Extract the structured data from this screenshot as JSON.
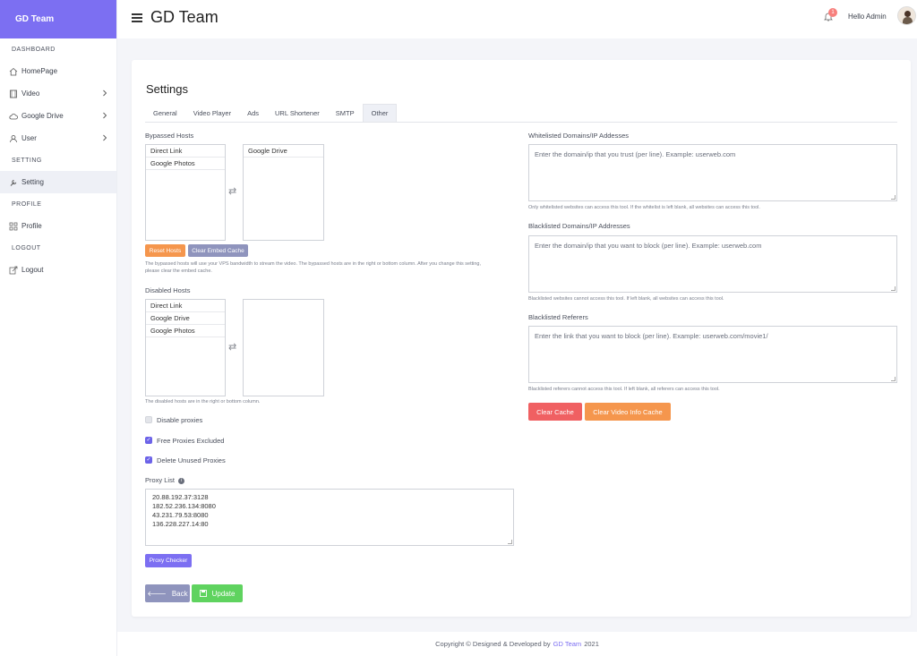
{
  "brand": "GD Team",
  "sidebar": {
    "sections": [
      {
        "title": "DASHBOARD",
        "items": [
          {
            "label": "HomePage",
            "icon": "home-icon",
            "chevron": false
          },
          {
            "label": "Video",
            "icon": "film-icon",
            "chevron": true
          },
          {
            "label": "Google Drive",
            "icon": "cloud-icon",
            "chevron": true
          },
          {
            "label": "User",
            "icon": "user-icon",
            "chevron": true
          }
        ]
      },
      {
        "title": "SETTING",
        "items": [
          {
            "label": "Setting",
            "icon": "wrench-icon",
            "active": true
          }
        ]
      },
      {
        "title": "PROFILE",
        "items": [
          {
            "label": "Profile",
            "icon": "grid-icon"
          }
        ]
      },
      {
        "title": "LOGOUT",
        "items": [
          {
            "label": "Logout",
            "icon": "logout-icon"
          }
        ]
      }
    ]
  },
  "topbar": {
    "title": "GD Team",
    "notification_count": "1",
    "greeting": "Hello Admin"
  },
  "page": {
    "title": "Settings",
    "tabs": [
      "General",
      "Video Player",
      "Ads",
      "URL Shortener",
      "SMTP",
      "Other"
    ],
    "active_tab": "Other"
  },
  "bypassed": {
    "label": "Bypassed Hosts",
    "left_options": [
      "Direct Link",
      "Google Photos"
    ],
    "right_options": [
      "Google Drive"
    ],
    "reset_label": "Reset Hosts",
    "clear_label": "Clear Embed Cache",
    "help_line1": "The bypassed hosts will use your VPS bandwidth to stream the video. The bypassed hosts are in the right or bottom column. After you change this setting,",
    "help_line2": "please clear the embed cache."
  },
  "disabled": {
    "label": "Disabled Hosts",
    "left_options": [
      "Direct Link",
      "Google Drive",
      "Google Photos"
    ],
    "right_options": [],
    "help": "The disabled hosts are in the right or bottom column."
  },
  "checkboxes": [
    {
      "label": "Disable proxies",
      "checked": false
    },
    {
      "label": "Free Proxies Excluded",
      "checked": true
    },
    {
      "label": "Delete Unused Proxies",
      "checked": true
    }
  ],
  "proxy": {
    "label": "Proxy List",
    "lines": [
      "20.88.192.37:3128",
      "182.52.236.134:8080",
      "43.231.79.53:8080",
      "136.228.227.14:80"
    ],
    "checker_label": "Proxy Checker"
  },
  "whitelist": {
    "label": "Whitelisted Domains/IP Addesses",
    "placeholder": "Enter the domain/ip that you trust (per line). Example: userweb.com",
    "help": "Only whitelisted websites can access this tool. If the whitelist is left blank, all websites can access this tool."
  },
  "blacklist": {
    "label": "Blacklisted Domains/IP Addresses",
    "placeholder": "Enter the domain/ip that you want to block (per line). Example: userweb.com",
    "help": "Blacklisted websites cannot access this tool. If left blank, all websites can access this tool."
  },
  "referers": {
    "label": "Blacklisted Referers",
    "placeholder": "Enter the link that you want to block (per line). Example: userweb.com/movie1/",
    "help": "Blacklisted referers cannot access this tool. If left blank, all referers can access this tool."
  },
  "actions": {
    "clear_cache": "Clear Cache",
    "clear_video_cache": "Clear Video Info Cache",
    "back": "Back",
    "update": "Update"
  },
  "footer": {
    "prefix": "Copyright © Designed & Developed by",
    "link": "GD Team",
    "year": "2021"
  },
  "colors": {
    "accent": "#7c6ff2",
    "orange": "#f5964d",
    "slate": "#8f94bd",
    "red": "#f06062",
    "green": "#5fd35f"
  }
}
